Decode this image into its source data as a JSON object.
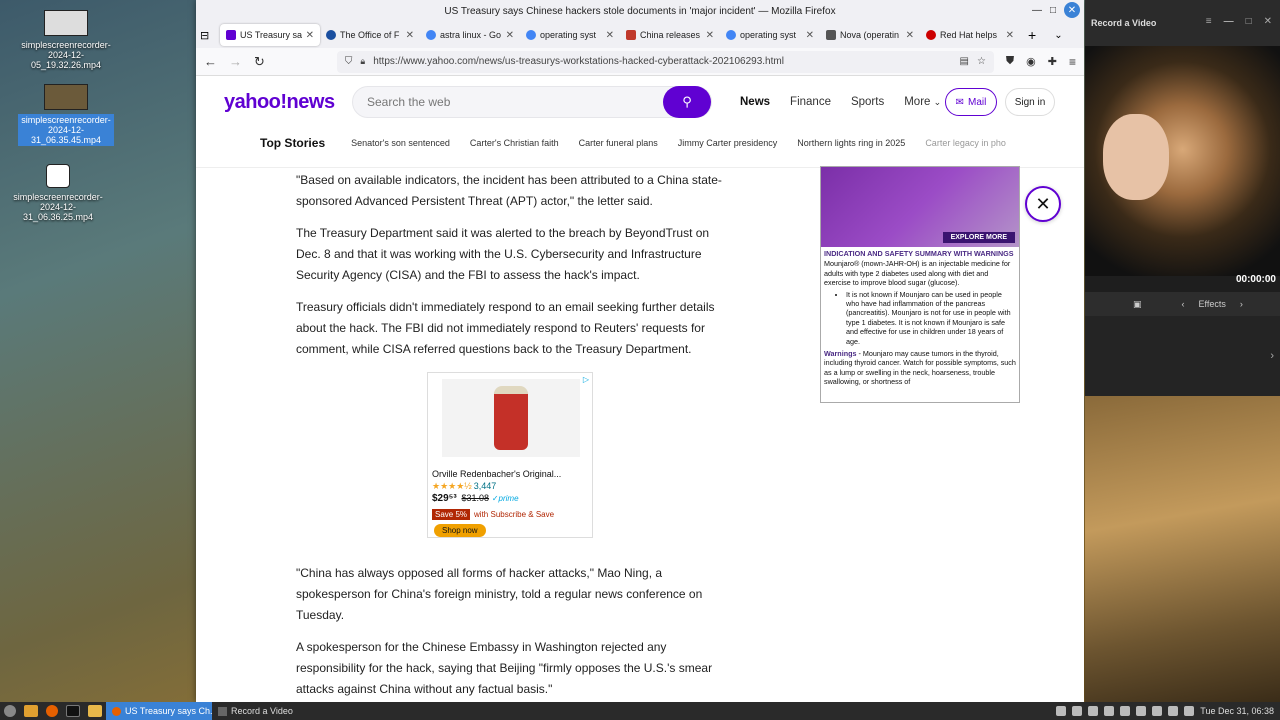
{
  "desktop": {
    "icons": [
      {
        "label": "simplescreenrecorder-2024-12-05_19.32.26.mp4"
      },
      {
        "label": "simplescreenrecorder-2024-12-31_06.35.45.mp4"
      },
      {
        "label": "simplescreenrecorder-2024-12-31_06.36.25.mp4"
      }
    ]
  },
  "firefox": {
    "window_title": "US Treasury says Chinese hackers stole documents in 'major incident' — Mozilla Firefox",
    "tabs": [
      {
        "label": "US Treasury sa",
        "color": "#6001d2"
      },
      {
        "label": "The Office of F",
        "color": "#1a4fa0"
      },
      {
        "label": "astra linux - Go",
        "color": "#4285f4"
      },
      {
        "label": "operating syst",
        "color": "#4285f4"
      },
      {
        "label": "China releases",
        "color": "#c0392b"
      },
      {
        "label": "operating syst",
        "color": "#4285f4"
      },
      {
        "label": "Nova (operatin",
        "color": "#555555"
      },
      {
        "label": "Red Hat helps",
        "color": "#cc0000"
      }
    ],
    "url": "https://www.yahoo.com/news/us-treasurys-workstations-hacked-cyberattack-202106293.html"
  },
  "yahoo": {
    "logo": "yahoo!news",
    "search_placeholder": "Search the web",
    "nav": [
      "News",
      "Finance",
      "Sports",
      "More"
    ],
    "mail": "Mail",
    "signin": "Sign in",
    "top_stories_title": "Top Stories",
    "top_stories": [
      "Senator's son sentenced",
      "Carter's Christian faith",
      "Carter funeral plans",
      "Jimmy Carter presidency",
      "Northern lights ring in 2025",
      "Carter legacy in pho"
    ]
  },
  "article": {
    "p1": "\"Based on available indicators, the incident has been attributed to a China state-sponsored Advanced Persistent Threat (APT) actor,\" the letter said.",
    "p2": "The Treasury Department said it was alerted to the breach by BeyondTrust on Dec. 8 and that it was working with the U.S. Cybersecurity and Infrastructure Security Agency (CISA) and the FBI to assess the hack's impact.",
    "p3": "Treasury officials didn't immediately respond to an email seeking further details about the hack. The FBI did not immediately respond to Reuters' requests for comment, while CISA referred questions back to the Treasury Department.",
    "p4": "\"China has always opposed all forms of hacker attacks,\" Mao Ning, a spokesperson for China's foreign ministry, told a regular news conference on Tuesday.",
    "p5": "A spokesperson for the Chinese Embassy in Washington rejected any responsibility for the hack, saying that Beijing \"firmly opposes the U.S.'s smear attacks against China without any factual basis.\""
  },
  "product_ad": {
    "name": "Orville Redenbacher's Original...",
    "stars": "★★★★½",
    "reviews": "3,447",
    "price": "$29⁵³",
    "old_price": "$31.08",
    "prime": "✓prime",
    "save": "Save 5%",
    "subscribe": "with Subscribe & Save",
    "shop": "Shop now"
  },
  "side_ad": {
    "explore": "EXPLORE MORE",
    "header": "INDICATION AND SAFETY SUMMARY WITH WARNINGS",
    "intro": "Mounjaro® (mown-JAHR-OH) is an injectable medicine for adults with type 2 diabetes used along with diet and exercise to improve blood sugar (glucose).",
    "bullet": "It is not known if Mounjaro can be used in people who have had inflammation of the pancreas (pancreatitis). Mounjaro is not for use in people with type 1 diabetes. It is not known if Mounjaro is safe and effective for use in children under 18 years of age.",
    "warn_label": "Warnings",
    "warn_text": " - Mounjaro may cause tumors in the thyroid, including thyroid cancer. Watch for possible symptoms, such as a lump or swelling in the neck, hoarseness, trouble swallowing, or shortness of"
  },
  "recorder": {
    "title": "Record a Video",
    "time": "00:00:00",
    "effects": "Effects"
  },
  "taskbar": {
    "task1": "US Treasury says Ch...",
    "task2": "Record a Video",
    "clock": "Tue Dec 31, 06:38"
  }
}
